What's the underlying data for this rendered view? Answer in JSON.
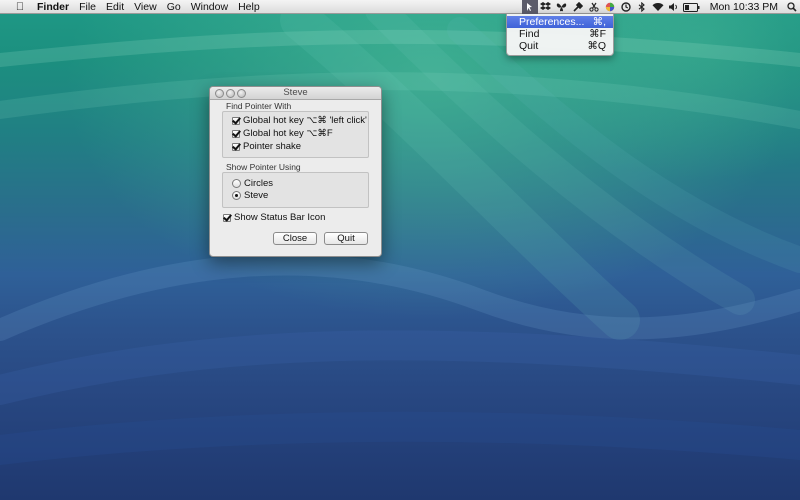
{
  "menubar": {
    "apple_icon": "apple-icon",
    "app_name": "Finder",
    "items": [
      "File",
      "Edit",
      "View",
      "Go",
      "Window",
      "Help"
    ],
    "status_icons": [
      "steve-status-icon",
      "dropbox-icon",
      "butterfly-icon",
      "tool-icon",
      "scissors-icon",
      "colorwheel-icon",
      "clock-icon",
      "bluetooth-icon",
      "wifi-icon",
      "volume-icon",
      "battery-icon"
    ],
    "clock": "Mon 10:33 PM",
    "spotlight_icon": "spotlight-icon"
  },
  "dropdown": {
    "items": [
      {
        "label": "Preferences...",
        "shortcut": "⌘,",
        "highlighted": true
      },
      {
        "label": "Find",
        "shortcut": "⌘F",
        "highlighted": false
      },
      {
        "label": "Quit",
        "shortcut": "⌘Q",
        "highlighted": false
      }
    ]
  },
  "window": {
    "title": "Steve",
    "find_group": {
      "label": "Find Pointer With",
      "options": [
        {
          "label": "Global hot key ⌥⌘ 'left click'",
          "checked": true
        },
        {
          "label": "Global hot key ⌥⌘F",
          "checked": true
        },
        {
          "label": "Pointer shake",
          "checked": true
        }
      ]
    },
    "show_group": {
      "label": "Show Pointer Using",
      "options": [
        {
          "label": "Circles",
          "selected": false
        },
        {
          "label": "Steve",
          "selected": true
        }
      ]
    },
    "status_bar_icon": {
      "label": "Show Status Bar Icon",
      "checked": true
    },
    "buttons": {
      "close": "Close",
      "quit": "Quit"
    }
  },
  "colors": {
    "menu_highlight": "#3f62d8",
    "desktop_top": "#1f9a86",
    "desktop_bottom": "#1f386f"
  }
}
